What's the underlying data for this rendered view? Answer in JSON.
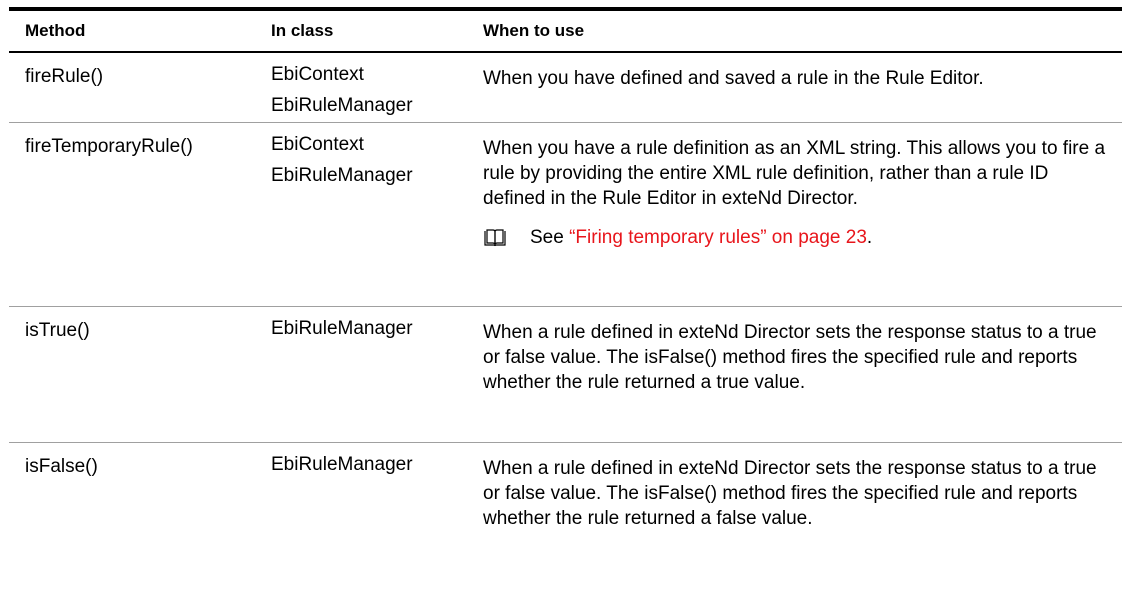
{
  "table": {
    "headers": [
      "Method",
      "In class",
      "When to use"
    ],
    "rows": [
      {
        "method": "fireRule()",
        "classes": [
          "EbiContext",
          "EbiRuleManager"
        ],
        "when": "When you have defined and saved a rule in the Rule Editor."
      },
      {
        "method": "fireTemporaryRule()",
        "classes": [
          "EbiContext",
          "EbiRuleManager"
        ],
        "when": "When you have a rule definition as an XML string. This allows you to fire a rule by providing the entire XML rule definition, rather than a rule ID defined in the Rule Editor in exteNd Director.",
        "see": {
          "icon": "book-icon",
          "prefix": "See ",
          "link": "“Firing temporary rules” on page 23",
          "suffix": "."
        }
      },
      {
        "method": "isTrue()",
        "classes": [
          "EbiRuleManager"
        ],
        "when": "When a rule defined in exteNd Director sets the response status to a true or false value. The isFalse() method fires the specified rule and reports whether the rule returned a true value."
      },
      {
        "method": "isFalse()",
        "classes": [
          "EbiRuleManager"
        ],
        "when": "When a rule defined in exteNd Director sets the response status to a true or false value. The isFalse() method fires the specified rule and reports whether the rule returned a false value."
      }
    ]
  },
  "colors": {
    "link": "#e8151b",
    "rule": "#000000",
    "divider": "#a0a0a0"
  }
}
